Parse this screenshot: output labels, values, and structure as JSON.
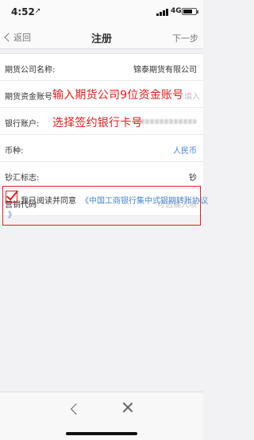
{
  "status_bar": {
    "time": "4:52",
    "arrow": "➚",
    "network": "4G"
  },
  "nav": {
    "back_label": "返回",
    "title": "注册",
    "next_label": "下一步"
  },
  "form": {
    "company": {
      "label": "期货公司名称:",
      "value": "锦泰期货有限公司"
    },
    "account": {
      "label": "期货资金账号",
      "placeholder_tail": "填入",
      "annotation": "输入期货公司9位资金账号"
    },
    "bank": {
      "label": "银行账户:",
      "annotation": "选择签约银行卡号"
    },
    "currency": {
      "label": "币种:",
      "value": "人民币"
    },
    "cash_flag": {
      "label": "钞汇标志:",
      "value": "钞"
    },
    "marketing": {
      "label": "营销代码",
      "placeholder": "可选输入项"
    }
  },
  "agreement": {
    "prefix": "我已阅读并同意",
    "link_line1": "《中国工商银行集中式银期转账协议",
    "link_line2": "》",
    "checked": true
  },
  "colors": {
    "annotation": "#e0201f",
    "link": "#4a84d6"
  },
  "icons": [
    "back-chevron-icon",
    "close-icon",
    "checkmark-icon",
    "signal-icon",
    "battery-icon",
    "location-arrow-icon"
  ]
}
